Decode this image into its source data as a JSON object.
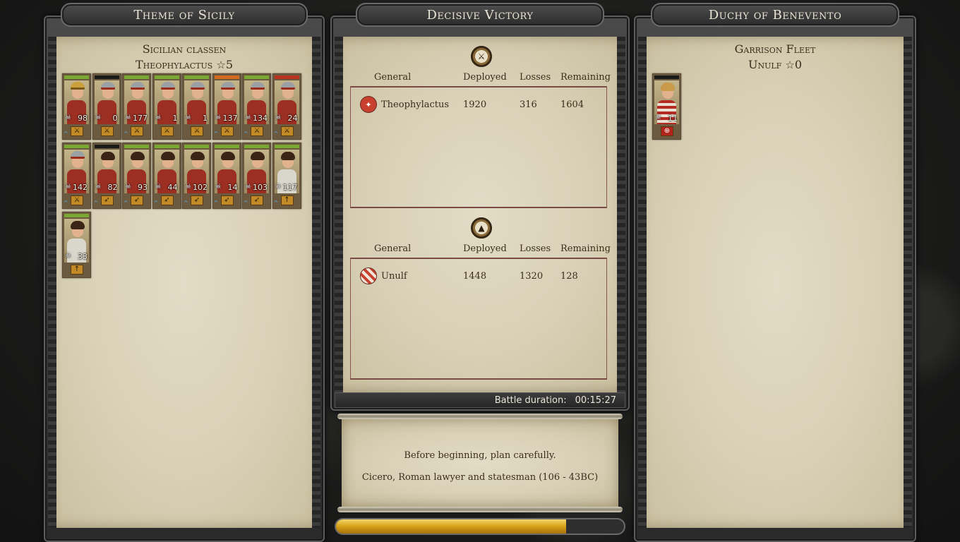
{
  "colors": {
    "parchment": "#d8d0b6",
    "frame": "#3a3a3a",
    "title_text": "#e9e4d5",
    "ink": "#3a2d1c",
    "progress": "#d6a018",
    "health_green": "#7aa832",
    "health_red": "#b8321e",
    "health_orange": "#d46a1e"
  },
  "left_panel": {
    "title": "Theme of Sicily",
    "army_name": "Sicilian classen",
    "general_name": "Theophylactus",
    "general_stars": "5",
    "units": [
      {
        "count": "98",
        "type_icon": "sword-icon",
        "health": "green",
        "look": "general",
        "rank": "^"
      },
      {
        "count": "0",
        "type_icon": "sword-icon",
        "health": "dark",
        "look": "helmet",
        "rank": ""
      },
      {
        "count": "177",
        "type_icon": "sword-icon",
        "health": "green",
        "look": "helmet",
        "rank": "^"
      },
      {
        "count": "1",
        "type_icon": "sword-icon",
        "health": "green",
        "look": "helmet",
        "rank": ""
      },
      {
        "count": "1",
        "type_icon": "sword-icon",
        "health": "green",
        "look": "helmet",
        "rank": ""
      },
      {
        "count": "137",
        "type_icon": "sword-icon",
        "health": "orange",
        "look": "helmet",
        "rank": "^"
      },
      {
        "count": "134",
        "type_icon": "sword-icon",
        "health": "green",
        "look": "helmet",
        "rank": "^"
      },
      {
        "count": "24",
        "type_icon": "sword-icon",
        "health": "red",
        "look": "helmet",
        "rank": "^"
      },
      {
        "count": "142",
        "type_icon": "sword-icon",
        "health": "green",
        "look": "helmet",
        "rank": "^"
      },
      {
        "count": "82",
        "type_icon": "bow-icon",
        "health": "dark",
        "look": "hair",
        "rank": "^"
      },
      {
        "count": "93",
        "type_icon": "bow-icon",
        "health": "green",
        "look": "hair",
        "rank": "^"
      },
      {
        "count": "44",
        "type_icon": "bow-icon",
        "health": "green",
        "look": "hair",
        "rank": "^"
      },
      {
        "count": "102",
        "type_icon": "bow-icon",
        "health": "green",
        "look": "hair",
        "rank": "^"
      },
      {
        "count": "14",
        "type_icon": "bow-icon",
        "health": "green",
        "look": "hair",
        "rank": "^"
      },
      {
        "count": "103",
        "type_icon": "bow-icon",
        "health": "green",
        "look": "hair",
        "rank": "^"
      },
      {
        "count": "117",
        "type_icon": "spear-icon",
        "health": "green",
        "look": "white",
        "rank": "^"
      },
      {
        "count": "33",
        "type_icon": "spear-icon",
        "health": "green",
        "look": "white",
        "rank": ""
      }
    ]
  },
  "center_panel": {
    "title": "Decisive Victory",
    "columns": {
      "general": "General",
      "deployed": "Deployed",
      "losses": "Losses",
      "remaining": "Remaining"
    },
    "attacker": {
      "general": "Theophylactus",
      "deployed": "1920",
      "losses": "316",
      "remaining": "1604"
    },
    "defender": {
      "general": "Unulf",
      "deployed": "1448",
      "losses": "1320",
      "remaining": "128"
    },
    "duration_label": "Battle duration:",
    "duration_value": "00:15:27",
    "quote_text": "Before beginning, plan carefully.",
    "quote_author": "Cicero, Roman lawyer and statesman (106 - 43BC)",
    "progress": 0.8
  },
  "right_panel": {
    "title": "Duchy of Benevento",
    "army_name": "Garrison Fleet",
    "general_name": "Unulf",
    "general_stars": "0",
    "units": [
      {
        "count": "11",
        "type_icon": "ship-icon",
        "health": "dark",
        "look": "stripe",
        "rank": ""
      }
    ]
  }
}
